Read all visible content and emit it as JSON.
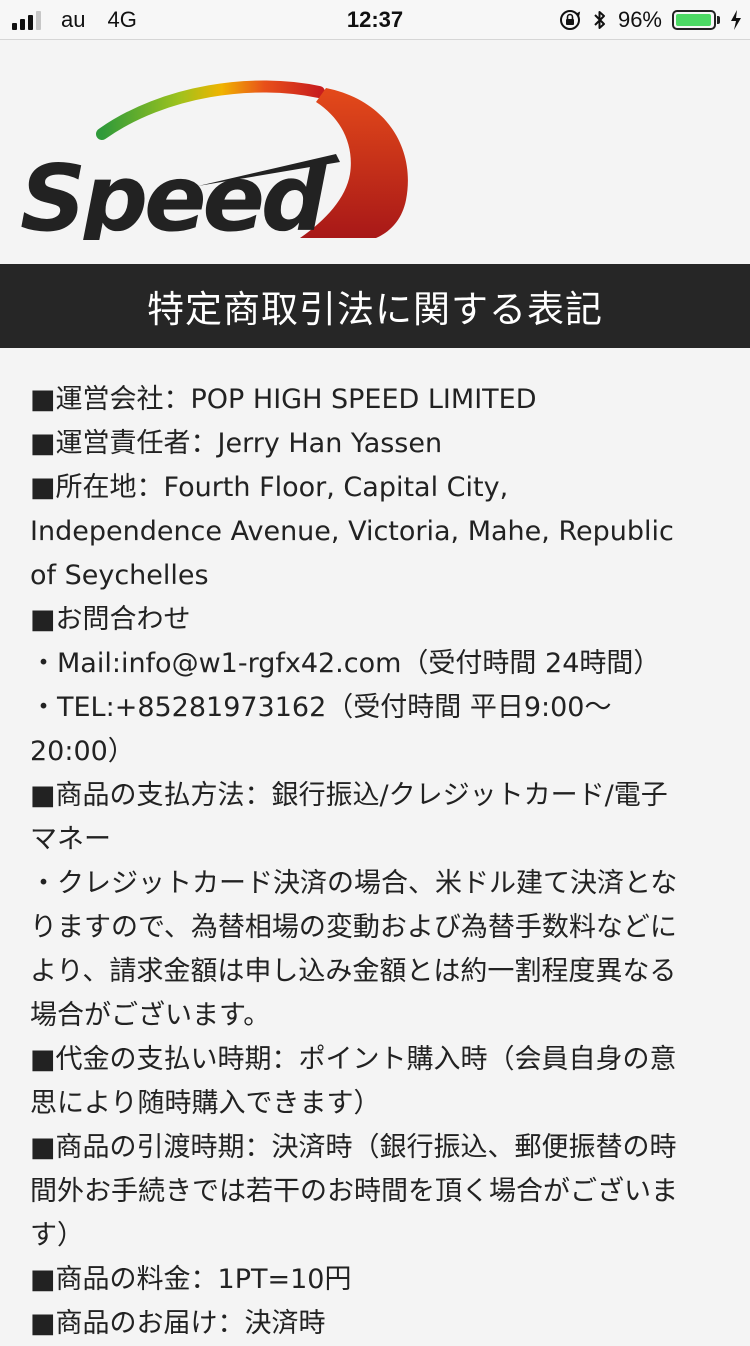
{
  "status_bar": {
    "carrier": "au",
    "network": "4G",
    "time": "12:37",
    "battery_percent": "96%",
    "battery_level": 0.96,
    "signal_bars": 3,
    "signal_total": 4
  },
  "logo": {
    "text": "Speed",
    "colors": [
      "#3a9a3a",
      "#e8b000",
      "#e04010",
      "#c81e1e"
    ]
  },
  "page": {
    "title": "特定商取引法に関する表記"
  },
  "content": {
    "lines": [
      "■運営会社：POP HIGH SPEED LIMITED",
      "■運営責任者：Jerry Han Yassen",
      "■所在地：Fourth Floor, Capital City,",
      "Independence Avenue, Victoria, Mahe, Republic",
      "of Seychelles",
      "■お問合わせ",
      "・Mail:info@w1-rgfx42.com（受付時間 24時間）",
      "・TEL:+85281973162（受付時間 平日9:00〜",
      "20:00）",
      "■商品の支払方法：銀行振込/クレジットカード/電子",
      "マネー",
      "・クレジットカード決済の場合、米ドル建て決済とな",
      "りますので、為替相場の変動および為替手数料などに",
      "より、請求金額は申し込み金額とは約一割程度異なる",
      "場合がございます。",
      "■代金の支払い時期：ポイント購入時（会員自身の意",
      "思により随時購入できます）",
      "■商品の引渡時期：決済時（銀行振込、郵便振替の時",
      "間外お手続きでは若干のお時間を頂く場合がございま",
      "す）",
      "■商品の料金：1PT=10円",
      "■商品のお届け：決済時"
    ]
  }
}
